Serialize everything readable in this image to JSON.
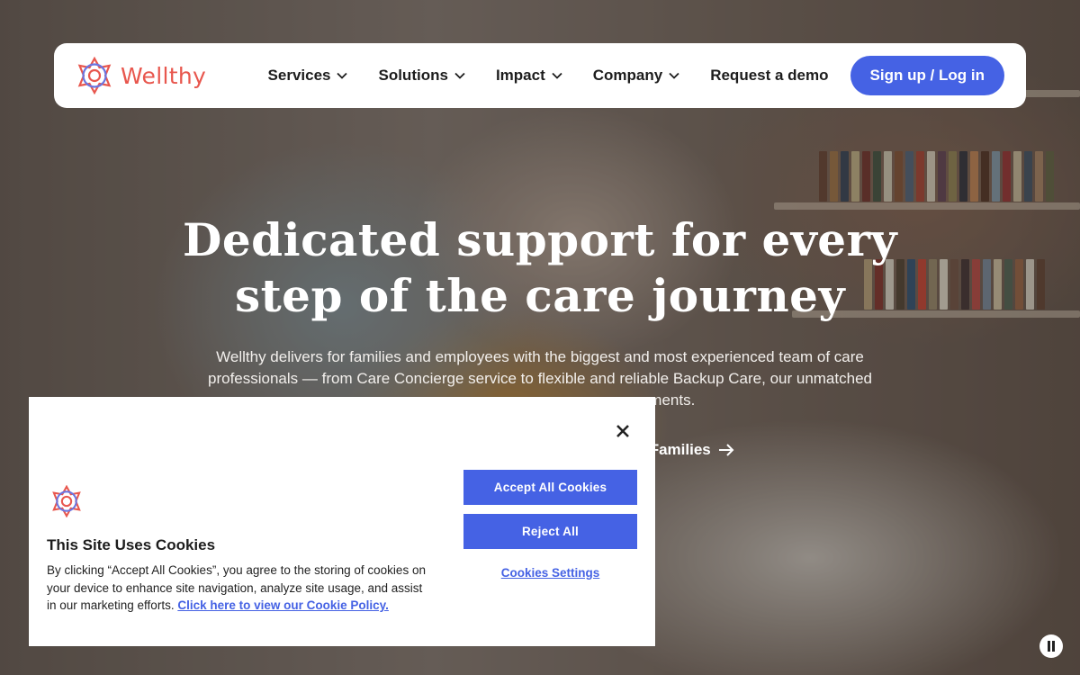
{
  "brand": {
    "name": "Wellthy",
    "color": "#e8574e",
    "accent": "#4562e4"
  },
  "nav": {
    "items": [
      {
        "label": "Services",
        "icon": "chevron-down-icon"
      },
      {
        "label": "Solutions",
        "icon": "chevron-down-icon"
      },
      {
        "label": "Impact",
        "icon": "chevron-down-icon"
      },
      {
        "label": "Company",
        "icon": "chevron-down-icon"
      }
    ],
    "demo_label": "Request a demo",
    "signup_label": "Sign up / Log in"
  },
  "hero": {
    "title_line1": "Dedicated support for every",
    "title_line2": "step of the care journey",
    "subtitle_line1": "Wellthy delivers for families and employees with the biggest and most experienced team of care",
    "subtitle_line2": "professionals — from Care Concierge service to flexible and reliable Backup Care, our unmatched",
    "subtitle_line3": "moments.",
    "families_link": "or Families"
  },
  "cookie": {
    "title": "This Site Uses Cookies",
    "text": "By clicking “Accept All Cookies”, you agree to the storing of cookies on your device to enhance site navigation, analyze site usage, and assist in our marketing efforts.",
    "policy_link": "Click here to view our Cookie Policy.",
    "accept_label": "Accept All Cookies",
    "reject_label": "Reject All",
    "settings_label": "Cookies Settings"
  }
}
